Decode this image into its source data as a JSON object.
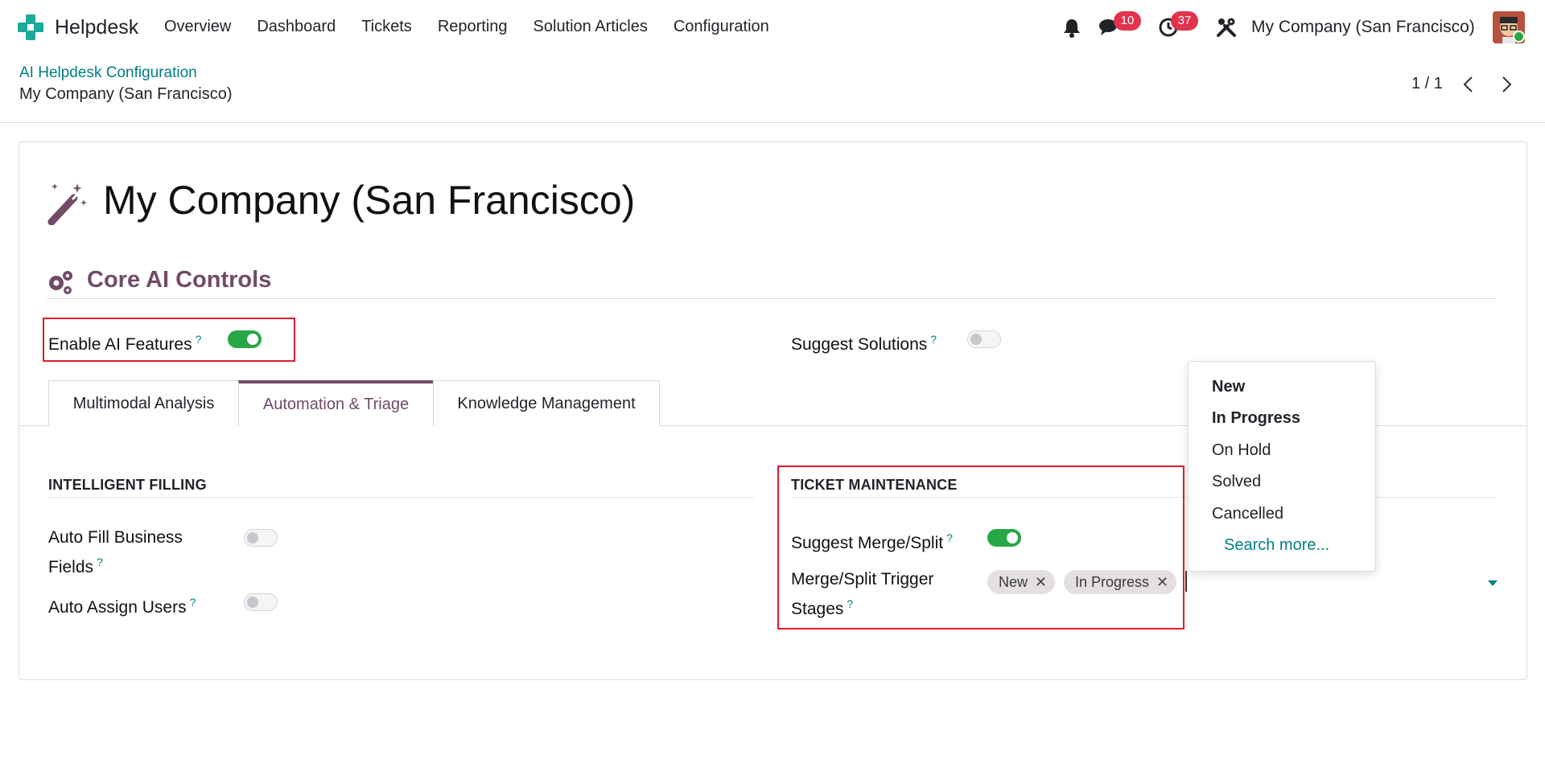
{
  "app": {
    "name": "Helpdesk",
    "menu": [
      "Overview",
      "Dashboard",
      "Tickets",
      "Reporting",
      "Solution Articles",
      "Configuration"
    ]
  },
  "systray": {
    "messages_count": "10",
    "activities_count": "37",
    "company": "My Company (San Francisco)"
  },
  "breadcrumb": {
    "parent": "AI Helpdesk Configuration",
    "current": "My Company (San Francisco)"
  },
  "pager": {
    "value": "1 / 1"
  },
  "record": {
    "title": "My Company (San Francisco)"
  },
  "core_section": {
    "title": "Core AI Controls",
    "enable_ai_label": "Enable AI Features",
    "enable_ai_value": true,
    "suggest_solutions_label": "Suggest Solutions",
    "suggest_solutions_value": false,
    "help_mark": "?"
  },
  "tabs": [
    {
      "label": "Multimodal Analysis",
      "active": false
    },
    {
      "label": "Automation & Triage",
      "active": true
    },
    {
      "label": "Knowledge Management",
      "active": false
    }
  ],
  "intelligent_filling": {
    "title": "INTELLIGENT FILLING",
    "auto_fill_label": "Auto Fill Business Fields",
    "auto_fill_value": false,
    "auto_assign_label": "Auto Assign Users",
    "auto_assign_value": false
  },
  "ticket_maintenance": {
    "title": "TICKET MAINTENANCE",
    "suggest_merge_label": "Suggest Merge/Split",
    "suggest_merge_value": true,
    "trigger_stages_label": "Merge/Split Trigger Stages",
    "trigger_stages_tags": [
      "New",
      "In Progress"
    ],
    "tag_remove_glyph": "✕"
  },
  "stage_dropdown": {
    "options": [
      {
        "label": "New",
        "bold": true
      },
      {
        "label": "In Progress",
        "bold": true
      },
      {
        "label": "On Hold",
        "bold": false
      },
      {
        "label": "Solved",
        "bold": false
      },
      {
        "label": "Cancelled",
        "bold": false
      }
    ],
    "search_more": "Search more..."
  },
  "colors": {
    "accent": "#714b67",
    "link": "#017e84",
    "toggle_on": "#28a745",
    "badge": "#e0334e",
    "highlight_box": "#e3182d"
  },
  "icons": [
    "helpdesk-logo-icon",
    "bell-icon",
    "chat-icon",
    "clock-icon",
    "tools-icon",
    "chevron-left-icon",
    "chevron-right-icon",
    "magic-wand-icon",
    "gears-icon",
    "close-icon",
    "caret-down-icon"
  ]
}
